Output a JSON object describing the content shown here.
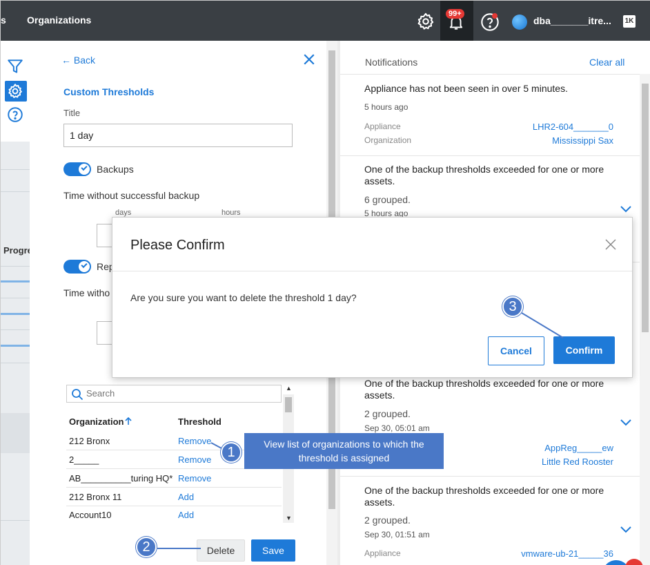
{
  "topbar": {
    "crumb_fragment": "s",
    "title": "Organizations",
    "badge": "99+",
    "user": "dba_______itre..."
  },
  "sidebar": {
    "column_fragment": "Progre"
  },
  "panel": {
    "back_label": "Back",
    "section_title": "Custom Thresholds",
    "title_label": "Title",
    "title_value": "1 day",
    "backups_label": "Backups",
    "backup_time_label": "Time without successful backup",
    "days_label": "days",
    "hours_label": "hours",
    "rep_label": "Rep",
    "time_without_label": "Time witho",
    "search_placeholder": "Search",
    "table": {
      "col_org": "Organization",
      "col_threshold": "Threshold",
      "rows": [
        {
          "org": "212 Bronx",
          "action": "Remove"
        },
        {
          "org": "2_____",
          "action": "Remove"
        },
        {
          "org": "AB__________turing HQ*",
          "action": "Remove"
        },
        {
          "org": "212 Bronx 11",
          "action": "Add"
        },
        {
          "org": "Account10",
          "action": "Add"
        }
      ]
    },
    "delete_label": "Delete",
    "save_label": "Save"
  },
  "notifications": {
    "header": "Notifications",
    "clear_all": "Clear all",
    "cards": [
      {
        "title": "Appliance has not been seen in over 5 minutes.",
        "time": "5 hours ago",
        "k1": "Appliance",
        "v1": "LHR2-604_______0",
        "k2": "Organization",
        "v2": "Mississippi Sax"
      },
      {
        "title": "One of the backup thresholds exceeded for one or more assets.",
        "grouped": "6 grouped.",
        "time": "5 hours ago"
      },
      {
        "title": "One of the backup thresholds exceeded for one or more assets.",
        "grouped": "2 grouped.",
        "time": "Sep 30, 05:01 am",
        "v1": "AppReg_____ew",
        "v2": "Little Red Rooster"
      },
      {
        "title": "One of the backup thresholds exceeded for one or more assets.",
        "grouped": "2 grouped.",
        "time": "Sep 30, 01:51 am",
        "k1": "Appliance",
        "v1": "vmware-ub-21_____36"
      }
    ]
  },
  "dialog": {
    "title": "Please Confirm",
    "message": "Are you sure you want to delete the threshold 1 day?",
    "cancel": "Cancel",
    "confirm": "Confirm"
  },
  "callouts": {
    "one": "1",
    "two": "2",
    "three": "3",
    "tip": "View list of organizations to which the threshold is assigned"
  },
  "colors": {
    "accent": "#1e7ad8",
    "topbar": "#3a3f44",
    "callout": "#4a78c7",
    "alert": "#e53935"
  }
}
